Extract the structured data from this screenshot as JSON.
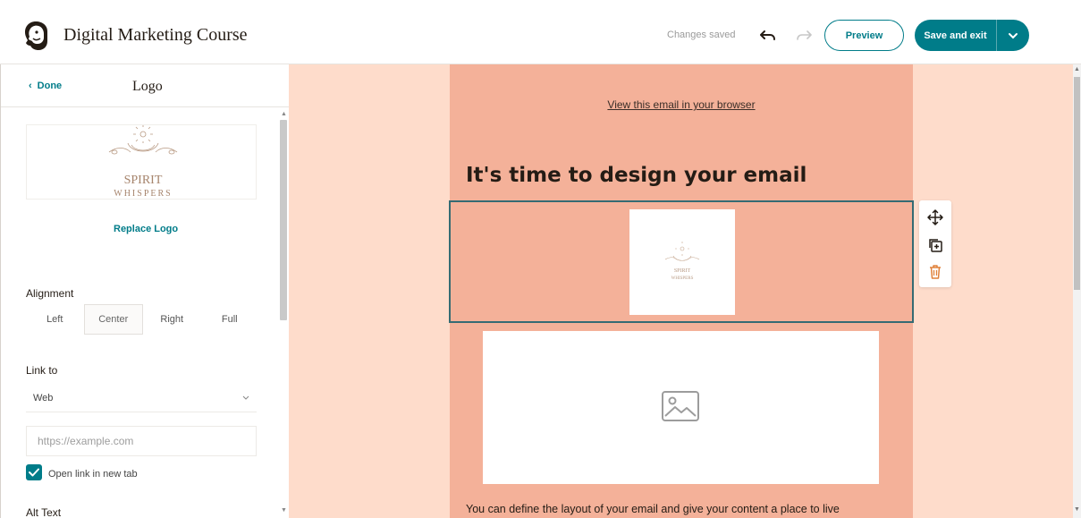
{
  "header": {
    "title": "Digital Marketing Course",
    "status": "Changes saved",
    "preview_label": "Preview",
    "save_label": "Save and exit",
    "icons": [
      "freddie-logo",
      "undo-icon",
      "redo-icon",
      "chevron-down-icon"
    ]
  },
  "panel": {
    "back_label": "Done",
    "title": "Logo",
    "logo_text_line1": "SPIRIT",
    "logo_text_line2": "WHISPERS",
    "replace_label": "Replace Logo",
    "alignment_label": "Alignment",
    "alignment_options": [
      "Left",
      "Center",
      "Right",
      "Full"
    ],
    "alignment_selected": "Center",
    "link_to_label": "Link to",
    "link_to_value": "Web",
    "url_placeholder": "https://example.com",
    "open_new_tab_label": "Open link in new tab",
    "open_new_tab_checked": true,
    "alt_text_label": "Alt Text"
  },
  "canvas": {
    "view_link": "View this email in your browser",
    "headline": "It's time to design your email",
    "body_text": "You can define the layout of your email and give your content a place to live",
    "colors": {
      "canvas_bg": "#fedccb",
      "email_bg": "#f4b199",
      "accent": "#007c89",
      "selected_border": "#356b73"
    },
    "block_tools": [
      "move-icon",
      "duplicate-icon",
      "delete-icon"
    ]
  }
}
